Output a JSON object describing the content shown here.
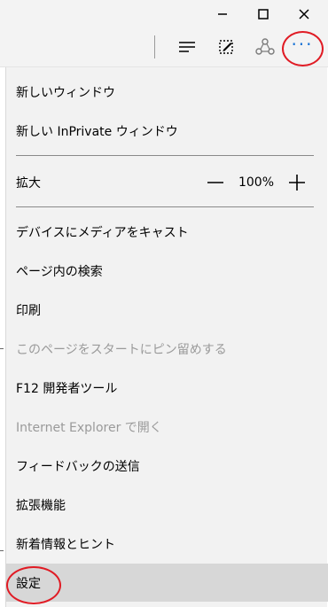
{
  "window_controls": {
    "minimize": "minimize-icon",
    "maximize": "maximize-icon",
    "close": "close-icon"
  },
  "toolbar": {
    "hub_icon": "hub-icon",
    "note_icon": "web-note-icon",
    "share_icon": "share-icon",
    "more_icon": "more-icon",
    "more_label": "···"
  },
  "menu": {
    "items": [
      {
        "label": "新しいウィンドウ"
      },
      {
        "label": "新しい InPrivate ウィンドウ"
      },
      {
        "label": "拡大"
      },
      {
        "label": "デバイスにメディアをキャスト"
      },
      {
        "label": "ページ内の検索"
      },
      {
        "label": "印刷"
      },
      {
        "label": "このページをスタートにピン留めする"
      },
      {
        "label": "F12 開発者ツール"
      },
      {
        "label": "Internet Explorer で開く"
      },
      {
        "label": "フィードバックの送信"
      },
      {
        "label": "拡張機能"
      },
      {
        "label": "新着情報とヒント"
      },
      {
        "label": "設定"
      }
    ],
    "zoom": {
      "value": "100%",
      "decrease_icon": "minus-icon",
      "increase_icon": "plus-icon"
    }
  },
  "colors": {
    "accent": "#1a74d6",
    "annotation": "#e01b24",
    "menu_bg": "#f2f2f2",
    "selected_bg": "#d7d7d7",
    "disabled_text": "#9a9a9a"
  }
}
